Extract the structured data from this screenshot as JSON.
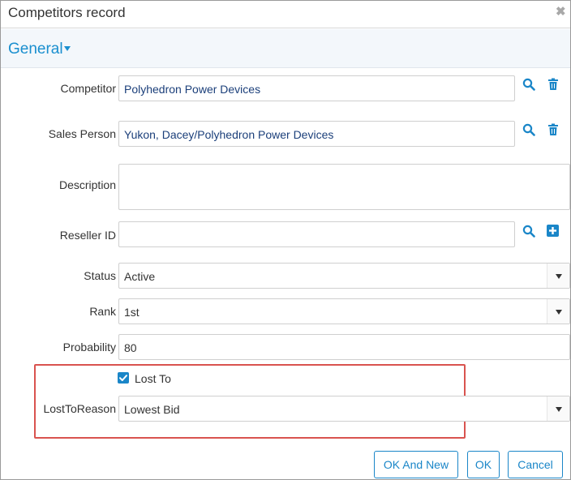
{
  "dialog": {
    "title": "Competitors record",
    "close_glyph": "✖"
  },
  "section": {
    "title": "General"
  },
  "fields": {
    "competitor": {
      "label": "Competitor",
      "value": "Polyhedron Power Devices"
    },
    "sales_person": {
      "label": "Sales Person",
      "value": "Yukon, Dacey/Polyhedron Power Devices"
    },
    "description": {
      "label": "Description",
      "value": ""
    },
    "reseller_id": {
      "label": "Reseller ID",
      "value": ""
    },
    "status": {
      "label": "Status",
      "value": "Active"
    },
    "rank": {
      "label": "Rank",
      "value": "1st"
    },
    "probability": {
      "label": "Probability",
      "value": "80"
    },
    "lost_to": {
      "label": "Lost To",
      "checked": true
    },
    "lost_to_reason": {
      "label": "LostToReason",
      "value": "Lowest Bid"
    }
  },
  "buttons": {
    "ok_and_new": "OK And New",
    "ok": "OK",
    "cancel": "Cancel"
  },
  "colors": {
    "accent": "#1a86c8",
    "highlight_border": "#d9534f",
    "link_text": "#1b3f7a"
  },
  "icons": {
    "search": "search-icon",
    "delete": "trash-icon",
    "add": "plus-square-icon"
  }
}
